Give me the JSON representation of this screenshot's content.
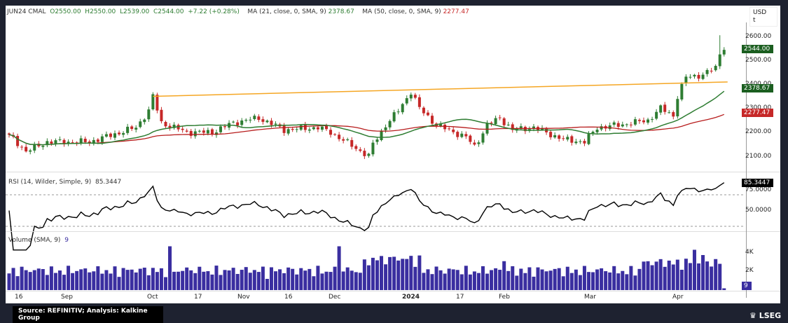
{
  "header": {
    "symbol": "JUN24 CMAL",
    "open": "O2550.00",
    "high": "H2550.00",
    "low": "L2539.00",
    "close": "C2544.00",
    "change": "+7.22 (+0.28%)",
    "ma21_label": "MA (21, close, 0, SMA, 9)",
    "ma21_value": "2378.67",
    "ma50_label": "MA (50, close, 0, SMA, 9)",
    "ma50_value": "2277.47"
  },
  "rsi": {
    "label": "RSI (14, Wilder, Simple, 9)",
    "value": "85.3447",
    "ticks": [
      "75.0000",
      "50.0000"
    ]
  },
  "volume": {
    "label": "Volume (SMA, 9)",
    "value": "9",
    "ticks": [
      "4K",
      "2K"
    ]
  },
  "axis": {
    "currency": "USD",
    "unit": "t",
    "price_ticks": [
      "2600.00",
      "2500.00",
      "2400.00",
      "2300.00",
      "2200.00",
      "2100.00"
    ],
    "last_price": "2544.00",
    "ma21_tag": "2378.67",
    "ma50_tag": "2277.47"
  },
  "x_labels": [
    "16",
    "Sep",
    "Oct",
    "17",
    "Nov",
    "16",
    "Dec",
    "2024",
    "17",
    "Feb",
    "Mar",
    "Apr"
  ],
  "footer": {
    "source": "Source: REFINITIV; Analysis: Kalkine Group",
    "brand": "LSEG"
  },
  "colors": {
    "up": "#2e7d32",
    "down": "#c62828",
    "ma21": "#2e7d32",
    "ma50": "#b71c1c",
    "trend": "#f5a623",
    "volume": "#3a2ea0"
  },
  "chart_data": {
    "type": "candlestick",
    "count": 170,
    "ylim": [
      2060,
      2660
    ],
    "close_anchors": [
      [
        0,
        2190
      ],
      [
        4,
        2120
      ],
      [
        9,
        2160
      ],
      [
        19,
        2160
      ],
      [
        30,
        2220
      ],
      [
        33,
        2290
      ],
      [
        34,
        2350
      ],
      [
        36,
        2240
      ],
      [
        42,
        2200
      ],
      [
        48,
        2200
      ],
      [
        53,
        2240
      ],
      [
        59,
        2260
      ],
      [
        65,
        2210
      ],
      [
        73,
        2220
      ],
      [
        76,
        2200
      ],
      [
        85,
        2100
      ],
      [
        86,
        2150
      ],
      [
        89,
        2230
      ],
      [
        92,
        2290
      ],
      [
        95,
        2370
      ],
      [
        97,
        2300
      ],
      [
        101,
        2230
      ],
      [
        108,
        2180
      ],
      [
        110,
        2140
      ],
      [
        113,
        2230
      ],
      [
        116,
        2260
      ],
      [
        119,
        2210
      ],
      [
        124,
        2220
      ],
      [
        131,
        2170
      ],
      [
        136,
        2160
      ],
      [
        139,
        2220
      ],
      [
        144,
        2230
      ],
      [
        151,
        2250
      ],
      [
        154,
        2300
      ],
      [
        157,
        2270
      ],
      [
        158,
        2350
      ],
      [
        160,
        2430
      ],
      [
        164,
        2440
      ],
      [
        167,
        2470
      ],
      [
        168,
        2530
      ],
      [
        169,
        2544
      ]
    ],
    "trendline": [
      [
        34,
        2350
      ],
      [
        169,
        2410
      ]
    ],
    "volume_peaks": [
      [
        38,
        5000
      ],
      [
        78,
        5000
      ],
      [
        84,
        3500
      ],
      [
        117,
        3300
      ],
      [
        162,
        4600
      ],
      [
        164,
        4000
      ]
    ]
  }
}
